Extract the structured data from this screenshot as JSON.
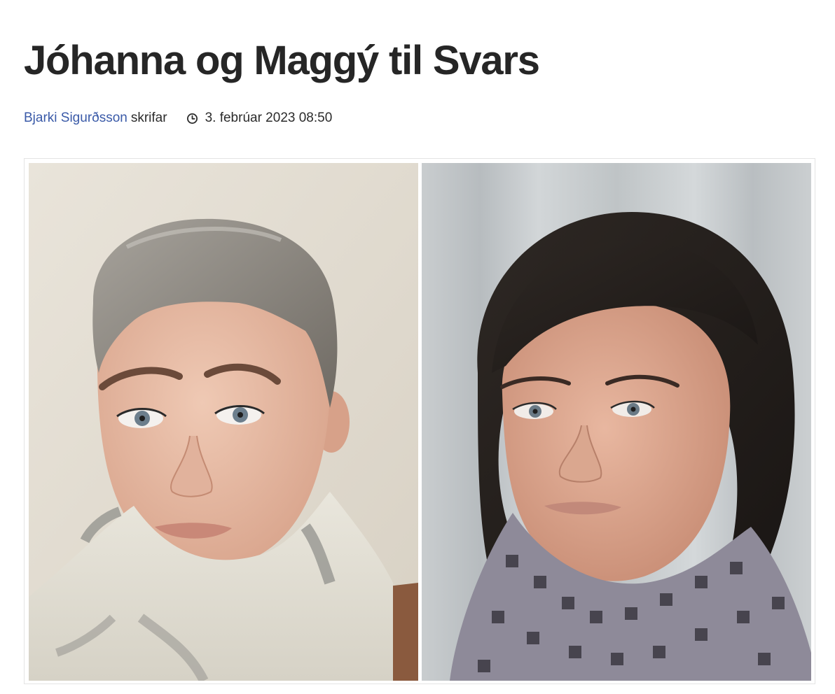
{
  "article": {
    "headline": "Jóhanna og Maggý til Svars",
    "author": {
      "name": "Bjarki Sigurðsson",
      "role": "skrifar"
    },
    "published": "3. febrúar 2023 08:50",
    "icons": {
      "time": "clock-icon"
    },
    "colors": {
      "link": "#3a5aa8",
      "headline": "#262626",
      "text": "#2b2b2b"
    },
    "photos": [
      {
        "subject": "portrait-left"
      },
      {
        "subject": "portrait-right"
      }
    ]
  }
}
